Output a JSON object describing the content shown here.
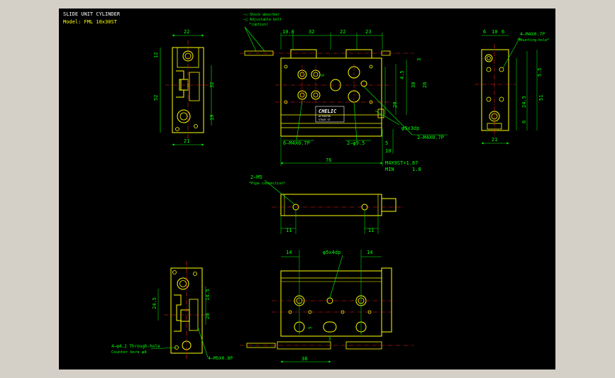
{
  "title_block": {
    "title": "SLIDE UNIT CYLINDER",
    "model": "Model: FML 10x30ST"
  },
  "legend": {
    "item1": "—▫ Shock absorber",
    "item2": "—□ Adjustable bolt",
    "item3": "*(option)"
  },
  "dims": {
    "left_top_width": "22",
    "left_height_12": "12",
    "left_height_52": "52",
    "left_32": "32",
    "left_19": "19",
    "left_21": "21",
    "front_10_8": "10.8",
    "front_32": "32",
    "front_22": "22",
    "front_23": "23",
    "front_3": "3",
    "front_5": "5",
    "front_4_5": "4.5",
    "front_30": "30",
    "front_26": "26",
    "front_20": "20",
    "front_76": "76",
    "front_5b": "5",
    "front_10": "10",
    "right_6": "6",
    "right_10": "10",
    "right_6b": "6",
    "right_5_5": "5.5",
    "right_24_5": "24.5",
    "right_51": "51",
    "right_6c": "6",
    "right_21": "21",
    "mid_11a": "11",
    "mid_11b": "11",
    "bot_14a": "14",
    "bot_14b": "14",
    "bot_38": "38",
    "bot_5": "5",
    "bot_3": "3",
    "bl_24_5": "24.5",
    "bl_14_5": "14.5",
    "bl_20": "20"
  },
  "callouts": {
    "m4x0_7p_top": "4—M4X0.7P",
    "mounting_hole": "*Mounting-hole*",
    "phi5x3dp": "φ5x3dp",
    "m4x0_7p_2": "2—M4X0.7P",
    "m4x0_7p_6": "6—M4X0.7P",
    "phi9_5": "2—φ9.5",
    "m4x9st": "M4X9ST+1.87",
    "min": "MIN",
    "min_val": "1.8",
    "m5": "2—M5",
    "pipe": "*Pipe connection*",
    "phi5x4dp": "φ5x4dp",
    "through_hole": "4—φ4.2  Through-hole",
    "counter_bore": "Counter bore  φ8",
    "m5x0_8p": "4—M5X0.8P"
  },
  "nameplate": {
    "brand": "CHELIC",
    "line1": "ACTUATOR",
    "line2": "STOCK ST"
  },
  "colors": {
    "background": "#000000",
    "frame": "#D4D0C8",
    "outline": "#FFFF00",
    "dimension": "#00FF00",
    "centerline": "#FF2020",
    "text": "#FFFFFF"
  }
}
